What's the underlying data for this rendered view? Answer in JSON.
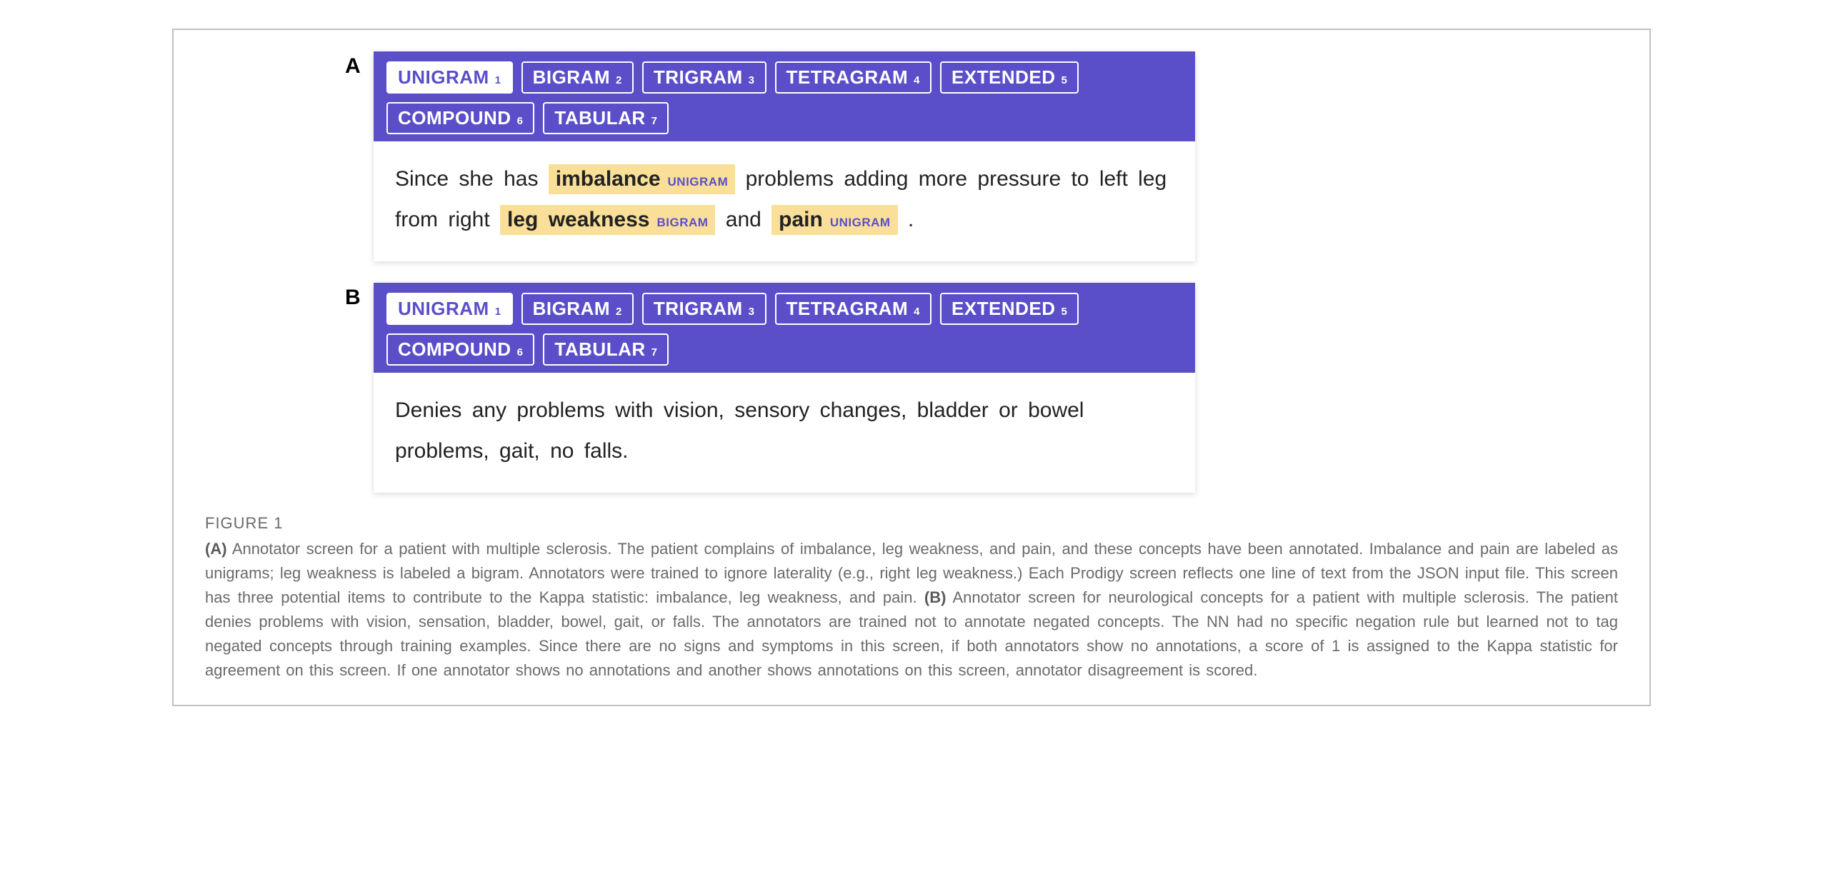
{
  "figure": {
    "number": "FIGURE 1",
    "panels": {
      "A": {
        "label": "A",
        "tags": [
          {
            "name": "UNIGRAM",
            "num": "1",
            "active": true
          },
          {
            "name": "BIGRAM",
            "num": "2",
            "active": false
          },
          {
            "name": "TRIGRAM",
            "num": "3",
            "active": false
          },
          {
            "name": "TETRAGRAM",
            "num": "4",
            "active": false
          },
          {
            "name": "EXTENDED",
            "num": "5",
            "active": false
          },
          {
            "name": "COMPOUND",
            "num": "6",
            "active": false
          },
          {
            "name": "TABULAR",
            "num": "7",
            "active": false
          }
        ],
        "sentence": {
          "pre1": "Since she has ",
          "hl1_term": "imbalance",
          "hl1_badge": "UNIGRAM",
          "mid1": " problems adding more pressure to left leg from right ",
          "hl2_term": "leg weakness",
          "hl2_badge": "BIGRAM",
          "mid2": " and ",
          "hl3_term": "pain",
          "hl3_badge": "UNIGRAM",
          "post": " ."
        }
      },
      "B": {
        "label": "B",
        "tags": [
          {
            "name": "UNIGRAM",
            "num": "1",
            "active": true
          },
          {
            "name": "BIGRAM",
            "num": "2",
            "active": false
          },
          {
            "name": "TRIGRAM",
            "num": "3",
            "active": false
          },
          {
            "name": "TETRAGRAM",
            "num": "4",
            "active": false
          },
          {
            "name": "EXTENDED",
            "num": "5",
            "active": false
          },
          {
            "name": "COMPOUND",
            "num": "6",
            "active": false
          },
          {
            "name": "TABULAR",
            "num": "7",
            "active": false
          }
        ],
        "sentence_plain": "Denies any problems with vision, sensory changes, bladder or bowel problems, gait, no falls."
      }
    },
    "caption": {
      "partA_label": "(A)",
      "partA_text": " Annotator screen for a patient with multiple sclerosis. The patient complains of imbalance, leg weakness, and pain, and these concepts have been annotated. Imbalance and pain are labeled as unigrams; leg weakness is labeled a bigram. Annotators were trained to ignore laterality (e.g., right leg weakness.) Each Prodigy screen reflects one line of text from the JSON input file. This screen has three potential items to contribute to the Kappa statistic: imbalance, leg weakness, and pain. ",
      "partB_label": "(B)",
      "partB_text": " Annotator screen for neurological concepts for a patient with multiple sclerosis. The patient denies problems with vision, sensation, bladder, bowel, gait, or falls. The annotators are trained not to annotate negated concepts. The NN had no specific negation rule but learned not to tag negated concepts through training examples. Since there are no signs and symptoms in this screen, if both annotators show no annotations, a score of 1 is assigned to the Kappa statistic for agreement on this screen. If one annotator shows no annotations and another shows annotations on this screen, annotator disagreement is scored."
    }
  }
}
